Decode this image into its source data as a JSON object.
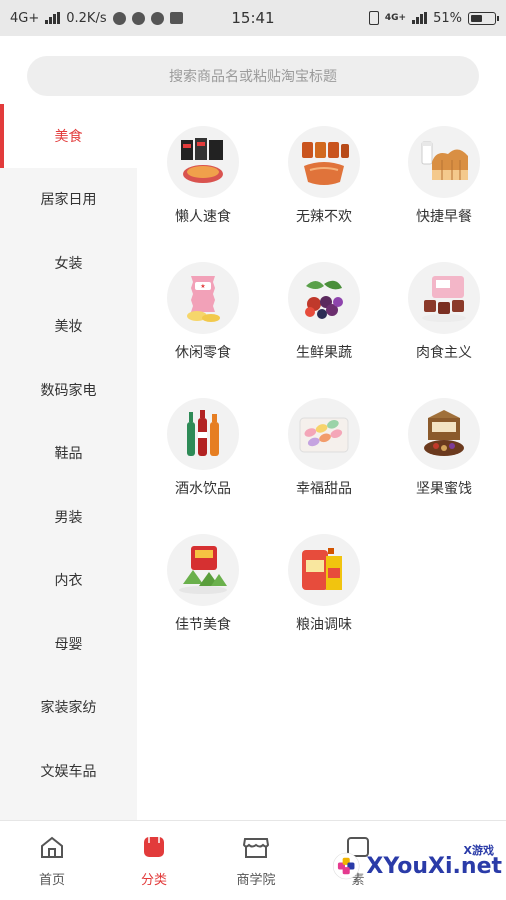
{
  "status_bar": {
    "network": "4G+",
    "speed": "0.2K/s",
    "time": "15:41",
    "net_right": "4G+",
    "battery_percent": "51%",
    "battery_level": 0.51
  },
  "search": {
    "placeholder": "搜索商品名或粘贴淘宝标题"
  },
  "sidebar": {
    "active_index": 0,
    "items": [
      {
        "label": "美食"
      },
      {
        "label": "居家日用"
      },
      {
        "label": "女装"
      },
      {
        "label": "美妆"
      },
      {
        "label": "数码家电"
      },
      {
        "label": "鞋品"
      },
      {
        "label": "男装"
      },
      {
        "label": "内衣"
      },
      {
        "label": "母婴"
      },
      {
        "label": "家装家纺"
      },
      {
        "label": "文娱车品"
      }
    ]
  },
  "categories": [
    {
      "label": "懒人速食",
      "icon": "instant-noodles-icon"
    },
    {
      "label": "无辣不欢",
      "icon": "spicy-snacks-icon"
    },
    {
      "label": "快捷早餐",
      "icon": "bread-breakfast-icon"
    },
    {
      "label": "休闲零食",
      "icon": "chips-snack-icon"
    },
    {
      "label": "生鲜果蔬",
      "icon": "fresh-fruit-icon"
    },
    {
      "label": "肉食主义",
      "icon": "meat-icon"
    },
    {
      "label": "酒水饮品",
      "icon": "drinks-icon"
    },
    {
      "label": "幸福甜品",
      "icon": "macaron-dessert-icon"
    },
    {
      "label": "坚果蜜饯",
      "icon": "nuts-gift-box-icon"
    },
    {
      "label": "佳节美食",
      "icon": "festival-zongzi-icon"
    },
    {
      "label": "粮油调味",
      "icon": "rice-oil-icon"
    }
  ],
  "tabbar": {
    "active_index": 1,
    "items": [
      {
        "label": "首页",
        "icon": "home-icon"
      },
      {
        "label": "分类",
        "icon": "category-icon"
      },
      {
        "label": "商学院",
        "icon": "store-icon"
      },
      {
        "label": "素",
        "icon": "material-icon"
      }
    ]
  },
  "watermark": {
    "text": "XYouXi.net",
    "small": "X游戏"
  },
  "colors": {
    "accent": "#e23b3b",
    "sidebar_bg": "#f5f5f5",
    "search_bg": "#eeeeee"
  }
}
